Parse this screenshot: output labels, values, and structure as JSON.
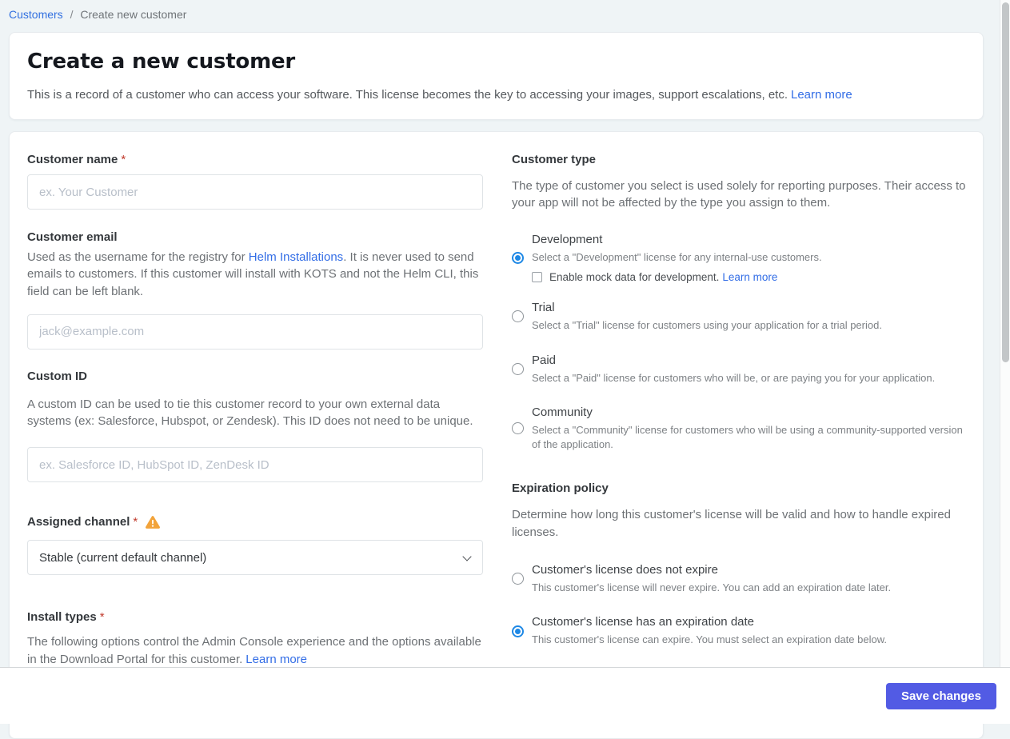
{
  "breadcrumb": {
    "customers": "Customers",
    "separator": "/",
    "current": "Create new customer"
  },
  "header": {
    "title": "Create a new customer",
    "description": "This is a record of a customer who can access your software. This license becomes the key to accessing your images, support escalations, etc.",
    "learn_more": "Learn more"
  },
  "left": {
    "customer_name": {
      "label": "Customer name",
      "required_mark": "*",
      "placeholder": "ex. Your Customer"
    },
    "customer_email": {
      "label": "Customer email",
      "desc_part1": "Used as the username for the registry for ",
      "desc_link": "Helm Installations",
      "desc_part2": ". It is never used to send emails to customers. If this customer will install with KOTS and not the Helm CLI, this field can be left blank.",
      "placeholder": "jack@example.com"
    },
    "custom_id": {
      "label": "Custom ID",
      "description": "A custom ID can be used to tie this customer record to your own external data systems (ex: Salesforce, Hubspot, or Zendesk). This ID does not need to be unique.",
      "placeholder": "ex. Salesforce ID, HubSpot ID, ZenDesk ID"
    },
    "assigned_channel": {
      "label": "Assigned channel",
      "required_mark": "*",
      "selected_option": "Stable (current default channel)"
    },
    "install_types": {
      "label": "Install types",
      "required_mark": "*",
      "description": "The following options control the Admin Console experience and the options available in the Download Portal for this customer.",
      "learn_more": "Learn more"
    }
  },
  "customer_type": {
    "label": "Customer type",
    "description": "The type of customer you select is used solely for reporting purposes. Their access to your app will not be affected by the type you assign to them.",
    "options": [
      {
        "title": "Development",
        "description": "Select a \"Development\" license for any internal-use customers.",
        "selected": true
      },
      {
        "title": "Trial",
        "description": "Select a \"Trial\" license for customers using your application for a trial period.",
        "selected": false
      },
      {
        "title": "Paid",
        "description": "Select a \"Paid\" license for customers who will be, or are paying you for your application.",
        "selected": false
      },
      {
        "title": "Community",
        "description": "Select a \"Community\" license for customers who will be using a community-supported version of the application.",
        "selected": false
      }
    ],
    "mock_data_checkbox": {
      "label": "Enable mock data for development.",
      "learn_more": "Learn more",
      "checked": false
    }
  },
  "expiration_policy": {
    "label": "Expiration policy",
    "description": "Determine how long this customer's license will be valid and how to handle expired licenses.",
    "options": [
      {
        "title": "Customer's license does not expire",
        "description": "This customer's license will never expire. You can add an expiration date later.",
        "selected": false
      },
      {
        "title": "Customer's license has an expiration date",
        "description": "This customer's license can expire. You must select an expiration date below.",
        "selected": true
      }
    ]
  },
  "footer": {
    "save_button": "Save changes"
  },
  "colors": {
    "link_blue": "#326de6",
    "radio_selected_blue": "#1e88e5",
    "button_indigo": "#525be4",
    "warning_orange": "#f2a33a",
    "required_red": "#c0392b",
    "page_background": "#eff4f6"
  }
}
